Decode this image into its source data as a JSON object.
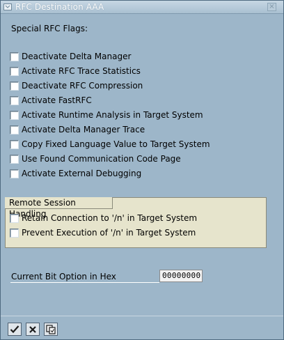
{
  "window": {
    "title": "RFC Destination AAA",
    "close_glyph": "×"
  },
  "flags": {
    "section_label": "Special RFC Flags:",
    "items": [
      {
        "label": "Deactivate Delta Manager",
        "checked": false
      },
      {
        "label": "Activate RFC Trace Statistics",
        "checked": false
      },
      {
        "label": "Deactivate RFC Compression",
        "checked": false
      },
      {
        "label": "Activate FastRFC",
        "checked": false
      },
      {
        "label": "Activate Runtime Analysis in Target System",
        "checked": false
      },
      {
        "label": "Activate Delta Manager Trace",
        "checked": false
      },
      {
        "label": "Copy Fixed Language Value to Target System",
        "checked": false
      },
      {
        "label": "Use Found Communication Code Page",
        "checked": false
      },
      {
        "label": "Activate External Debugging",
        "checked": false
      }
    ]
  },
  "remote_session": {
    "title": "Remote Session Handling",
    "items": [
      {
        "label": "Retain Connection to '/n' in Target System",
        "checked": false
      },
      {
        "label": "Prevent Execution of '/n' in Target System",
        "checked": false
      }
    ]
  },
  "bit_option": {
    "label": "Current Bit Option in Hex",
    "value": "00000000"
  },
  "toolbar": {
    "buttons": [
      {
        "icon": "checkmark-icon",
        "name": "confirm-button"
      },
      {
        "icon": "cancel-x-icon",
        "name": "cancel-button"
      },
      {
        "icon": "copy-icon",
        "name": "copy-button"
      }
    ]
  },
  "colors": {
    "window_bg": "#9db6c9",
    "group_bg": "#e6e4cc",
    "title_text": "#ffffff"
  }
}
